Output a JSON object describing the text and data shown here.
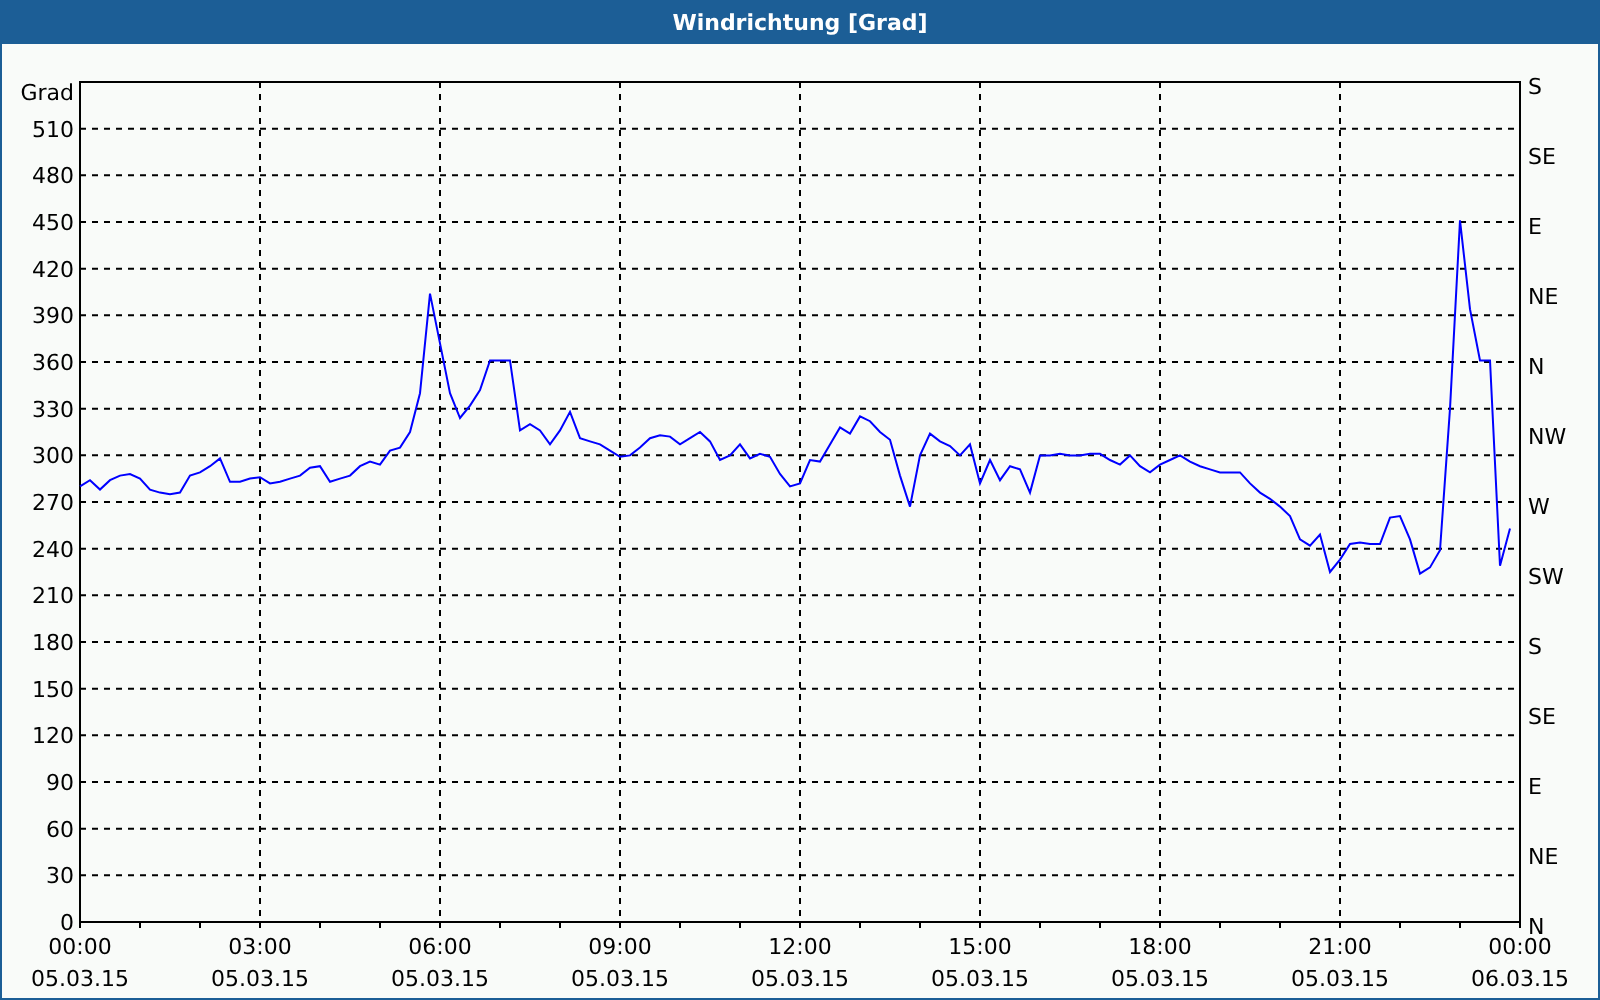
{
  "window": {
    "title": "Windrichtung [Grad]"
  },
  "chart_data": {
    "type": "line",
    "ylabel": "Grad",
    "grid": true,
    "ylim": [
      0,
      540
    ],
    "yticks": [
      0,
      30,
      60,
      90,
      120,
      150,
      180,
      210,
      240,
      270,
      300,
      330,
      360,
      390,
      420,
      450,
      480,
      510
    ],
    "categories": [
      "00:00",
      null,
      null,
      null,
      null,
      null,
      null,
      null,
      null,
      null,
      null,
      null,
      null,
      null,
      null,
      null,
      null,
      null,
      "03:00",
      null,
      null,
      null,
      null,
      null,
      null,
      null,
      null,
      null,
      null,
      null,
      null,
      null,
      null,
      null,
      null,
      null,
      "06:00",
      null,
      null,
      null,
      null,
      null,
      null,
      null,
      null,
      null,
      null,
      null,
      null,
      null,
      null,
      null,
      null,
      null,
      "09:00",
      null,
      null,
      null,
      null,
      null,
      null,
      null,
      null,
      null,
      null,
      null,
      null,
      null,
      null,
      null,
      null,
      null,
      "12:00",
      null,
      null,
      null,
      null,
      null,
      null,
      null,
      null,
      null,
      null,
      null,
      null,
      null,
      null,
      null,
      null,
      null,
      "15:00",
      null,
      null,
      null,
      null,
      null,
      null,
      null,
      null,
      null,
      null,
      null,
      null,
      null,
      null,
      null,
      null,
      null,
      "18:00",
      null,
      null,
      null,
      null,
      null,
      null,
      null,
      null,
      null,
      null,
      null,
      null,
      null,
      null,
      null,
      null,
      null,
      "21:00",
      null,
      null,
      null,
      null,
      null,
      null,
      null,
      null,
      null,
      null,
      null,
      null,
      null,
      null,
      null,
      null,
      null,
      "00:00"
    ],
    "series": [
      {
        "color": "#0000ff",
        "values": [
          280,
          284,
          278,
          284,
          287,
          288,
          285,
          278,
          276,
          275,
          276,
          287,
          289,
          293,
          298,
          283,
          283,
          285,
          286,
          282,
          283,
          285,
          287,
          292,
          293,
          283,
          285,
          287,
          293,
          296,
          294,
          303,
          305,
          315,
          340,
          404,
          372,
          340,
          324,
          332,
          342,
          361,
          361,
          361,
          316,
          320,
          316,
          307,
          316,
          328,
          311,
          309,
          307,
          303,
          299,
          300,
          305,
          311,
          313,
          312,
          307,
          311,
          315,
          309,
          297,
          300,
          307,
          298,
          301,
          299,
          288,
          280,
          282,
          297,
          296,
          307,
          318,
          314,
          325,
          322,
          315,
          310,
          287,
          267,
          300,
          314,
          309,
          306,
          300,
          307,
          282,
          297,
          284,
          293,
          291,
          276,
          300,
          300,
          301,
          300,
          300,
          301,
          301,
          297,
          294,
          300,
          293,
          289,
          294,
          297,
          300,
          296,
          293,
          291,
          289,
          289,
          289,
          282,
          276,
          272,
          267,
          261,
          246,
          242,
          249,
          225,
          233,
          243,
          244,
          243,
          243,
          260,
          261,
          246,
          224,
          228,
          239,
          330,
          451,
          394,
          361,
          361,
          229,
          253,
          null
        ]
      }
    ]
  },
  "dates": [
    "05.03.15",
    "05.03.15",
    "05.03.15",
    "05.03.15",
    "05.03.15",
    "05.03.15",
    "05.03.15",
    "05.03.15",
    "06.03.15"
  ],
  "compass_axis": [
    "S",
    "SE",
    "E",
    "NE",
    "N",
    "NW",
    "W",
    "SW",
    "S",
    "SE",
    "E",
    "NE",
    "N"
  ]
}
